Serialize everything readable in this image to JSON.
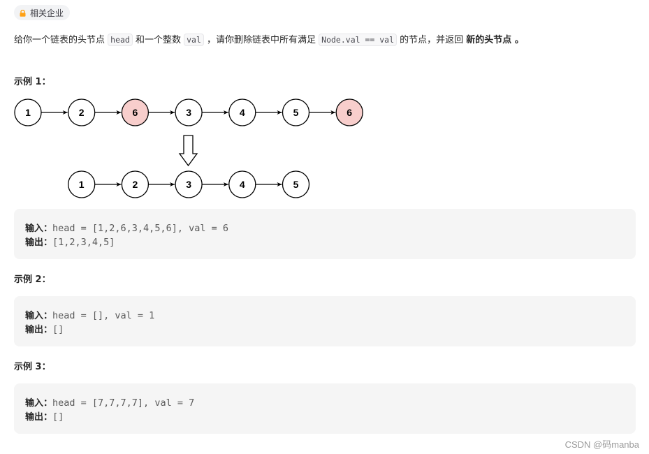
{
  "tag": {
    "icon": "lock-icon",
    "label": "相关企业",
    "icon_color": "#ffa116"
  },
  "description": {
    "p1": "给你一个链表的头节点 ",
    "code1": "head",
    "p2": " 和一个整数 ",
    "code2": "val",
    "p3": " ，请你删除链表中所有满足 ",
    "code3": "Node.val == val",
    "p4": " 的节点，并返回 ",
    "bold": "新的头节点",
    "p5": " 。"
  },
  "examples": [
    {
      "title": "示例 1：",
      "input_label": "输入：",
      "input": "head = [1,2,6,3,4,5,6], val = 6",
      "output_label": "输出：",
      "output": "[1,2,3,4,5]"
    },
    {
      "title": "示例 2：",
      "input_label": "输入：",
      "input": "head = [], val = 1",
      "output_label": "输出：",
      "output": "[]"
    },
    {
      "title": "示例 3：",
      "input_label": "输入：",
      "input": "head = [7,7,7,7], val = 7",
      "output_label": "输出：",
      "output": "[]"
    }
  ],
  "diagram": {
    "before": [
      {
        "value": "1",
        "removed": false
      },
      {
        "value": "2",
        "removed": false
      },
      {
        "value": "6",
        "removed": true
      },
      {
        "value": "3",
        "removed": false
      },
      {
        "value": "4",
        "removed": false
      },
      {
        "value": "5",
        "removed": false
      },
      {
        "value": "6",
        "removed": true
      }
    ],
    "after": [
      "1",
      "2",
      "3",
      "4",
      "5"
    ],
    "removed_fill": "#f8cecc",
    "normal_fill": "#ffffff"
  },
  "watermark": "CSDN @码manba"
}
